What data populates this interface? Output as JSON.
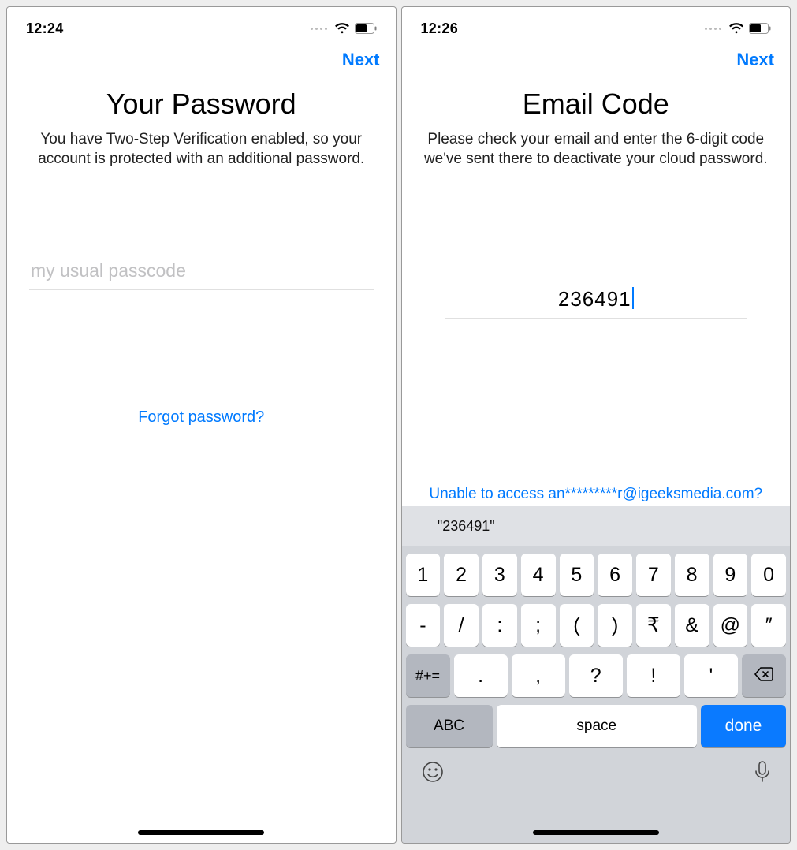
{
  "screen1": {
    "status": {
      "time": "12:24"
    },
    "nav": {
      "next": "Next"
    },
    "title": "Your Password",
    "subtitle": "You have Two-Step Verification enabled, so your account is protected with an additional password.",
    "password": {
      "placeholder": "my usual passcode",
      "value": ""
    },
    "forgot": "Forgot password?"
  },
  "screen2": {
    "status": {
      "time": "12:26"
    },
    "nav": {
      "next": "Next"
    },
    "title": "Email Code",
    "subtitle": "Please check your email and enter the 6-digit code we've sent there to deactivate your cloud password.",
    "code": {
      "value": "236491"
    },
    "unable": "Unable to access an*********r@igeeksmedia.com?",
    "keyboard": {
      "suggestion": "\"236491\"",
      "row1": [
        "1",
        "2",
        "3",
        "4",
        "5",
        "6",
        "7",
        "8",
        "9",
        "0"
      ],
      "row2": [
        "-",
        "/",
        ":",
        ";",
        "(",
        ")",
        "₹",
        "&",
        "@",
        "″"
      ],
      "row3_mod": "#+=",
      "row3": [
        ".",
        ",",
        "?",
        "!",
        "'"
      ],
      "abc": "ABC",
      "space": "space",
      "done": "done"
    }
  }
}
